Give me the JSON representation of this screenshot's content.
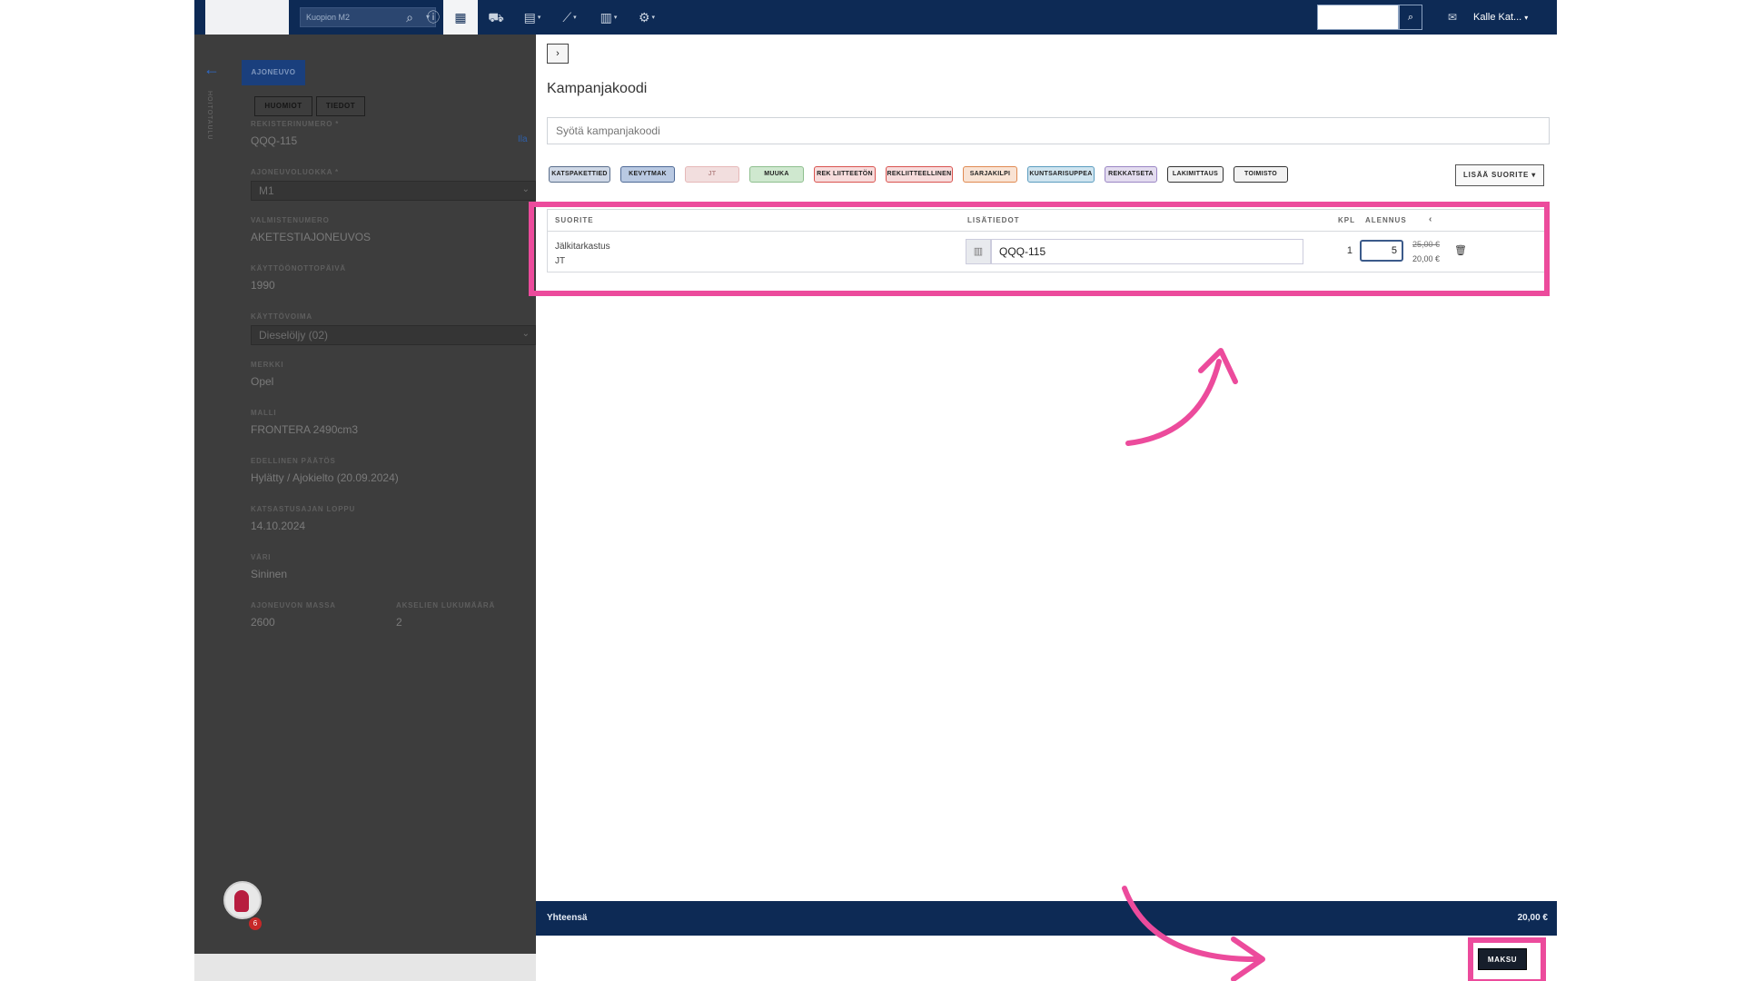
{
  "topbar": {
    "location": "Kuopion M2",
    "user": "Kalle Kat...",
    "icons": [
      "search-icon",
      "info-icon",
      "calendar-icon",
      "car-icon",
      "clipboard-icon",
      "chart-icon",
      "document-icon",
      "gear-icon",
      "mail-icon"
    ]
  },
  "left_panel": {
    "vertical_label": "HOITOTAULU",
    "main_tab": "AJONEUVO",
    "sub_tabs": [
      "HUOMIOT",
      "TIEDOT"
    ],
    "help_link": "Ila",
    "fields": [
      {
        "label": "REKISTERINUMERO *",
        "value": "QQQ-115"
      },
      {
        "label": "AJONEUVOLUOKKA *",
        "value": "M1"
      },
      {
        "label": "VALMISTENUMERO",
        "value": "AKETESTIAJONEUVOS"
      },
      {
        "label": "KÄYTTÖÖNOTTOPÄIVÄ",
        "value": "1990"
      },
      {
        "label": "KÄYTTÖVOIMA",
        "value": "Dieselöljy (02)"
      },
      {
        "label": "MERKKI",
        "value": "Opel"
      },
      {
        "label": "MALLI",
        "value": "FRONTERA 2490cm3"
      },
      {
        "label": "EDELLINEN PÄÄTÖS",
        "value": "Hylätty / Ajokielto (20.09.2024)"
      },
      {
        "label": "KATSASTUSAJAN LOPPU",
        "value": "14.10.2024"
      },
      {
        "label": "VÄRI",
        "value": "Sininen"
      },
      {
        "label": "AJONEUVON MASSA",
        "value": "2600"
      },
      {
        "label": "AKSELIEN LUKUMÄÄRÄ",
        "value": "2"
      }
    ],
    "notification_count": "6"
  },
  "main": {
    "campaign_title": "Kampanjakoodi",
    "campaign_placeholder": "Syötä kampanjakoodi",
    "chips": [
      {
        "label": "KATSPAKETTIED",
        "color": "#cfd8e6",
        "border": "#5a6e8c"
      },
      {
        "label": "KEVYTMAK",
        "color": "#b9c9e2",
        "border": "#4f6a96"
      },
      {
        "label": "JT",
        "color": "#f2dede",
        "border": "#e6b8b8"
      },
      {
        "label": "MUUKA",
        "color": "#cfe8cf",
        "border": "#8fbf8f"
      },
      {
        "label": "REK LIITTEETÖN",
        "color": "#f7dcdc",
        "border": "#d9534f"
      },
      {
        "label": "REKLIITTEELLINEN",
        "color": "#f7dcdc",
        "border": "#d9534f"
      },
      {
        "label": "SARJAKILPI",
        "color": "#f9e3d4",
        "border": "#e08a52"
      },
      {
        "label": "KUNTSARISUPPEA",
        "color": "#cfe4ef",
        "border": "#5b9cbf"
      },
      {
        "label": "REKKATSETA",
        "color": "#e3dcef",
        "border": "#9a86c4"
      },
      {
        "label": "LAKIMITTAUS",
        "color": "#f2f2f2",
        "border": "#333333"
      },
      {
        "label": "TOIMISTO",
        "color": "#f2f2f2",
        "border": "#333333"
      }
    ],
    "add_service": "LISÄÄ SUORITE",
    "table": {
      "headers": {
        "service": "SUORITE",
        "info": "LISÄTIEDOT",
        "qty": "KPL",
        "discount": "ALENNUS",
        "collapse": "‹"
      },
      "row": {
        "service": "Jälkitarkastus",
        "service_code": "JT",
        "registration": "QQQ-115",
        "qty": "1",
        "discount": "5",
        "old_price": "25,00 €",
        "new_price": "20,00 €"
      }
    },
    "total_label": "Yhteensä",
    "total_value": "20,00 €",
    "pay_button": "MAKSU"
  },
  "colors": {
    "navy": "#0d2a55",
    "highlight": "#ec4b9c"
  }
}
